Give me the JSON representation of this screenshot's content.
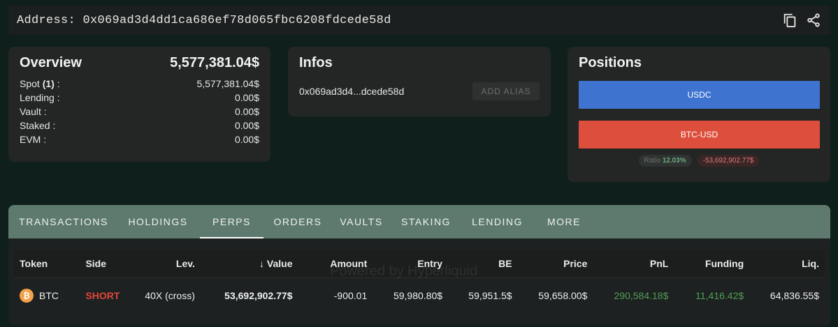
{
  "address": {
    "label": "Address:",
    "value": "0x069ad3d4dd1ca686ef78d065fbc6208fdcede58d",
    "copy_icon": "copy-icon",
    "share_icon": "share-icon"
  },
  "overview": {
    "title": "Overview",
    "total": "5,577,381.04$",
    "spot_label": "Spot",
    "spot_count": "(1)",
    "spot_colon": ":",
    "spot_value": "5,577,381.04$",
    "rows": [
      {
        "label": "Lending :",
        "value": "0.00$"
      },
      {
        "label": "Vault :",
        "value": "0.00$"
      },
      {
        "label": "Staked :",
        "value": "0.00$"
      },
      {
        "label": "EVM :",
        "value": "0.00$"
      }
    ]
  },
  "infos": {
    "title": "Infos",
    "short_address": "0x069ad3d4...dcede58d",
    "alias_button": "ADD ALIAS"
  },
  "positions": {
    "title": "Positions",
    "bars": [
      "USDC",
      "BTC-USD"
    ],
    "ratio_label": "Ratio",
    "ratio_value": "12.03%",
    "loss_value": "-53,692,902.77$",
    "colors": {
      "usdc": "#3e74d0",
      "btc": "#dd4f3c"
    }
  },
  "tabs": [
    "TRANSACTIONS",
    "HOLDINGS",
    "PERPS",
    "ORDERS",
    "VAULTS",
    "STAKING",
    "LENDING",
    "MORE"
  ],
  "active_tab": "PERPS",
  "table": {
    "sort_icon": "arrow-down-icon",
    "columns": [
      "Token",
      "Side",
      "Lev.",
      "Value",
      "Amount",
      "Entry",
      "BE",
      "Price",
      "PnL",
      "Funding",
      "Liq."
    ],
    "rows": [
      {
        "token": "BTC",
        "token_icon": "bitcoin-icon",
        "side": "SHORT",
        "lev": "40X (cross)",
        "value": "53,692,902.77$",
        "amount": "-900.01",
        "entry": "59,980.80$",
        "be": "59,951.5$",
        "price": "59,658.00$",
        "pnl": "290,584.18$",
        "funding": "11,416.42$",
        "liq": "64,836.55$"
      }
    ]
  },
  "watermark": "Powered by Hyperliquid"
}
